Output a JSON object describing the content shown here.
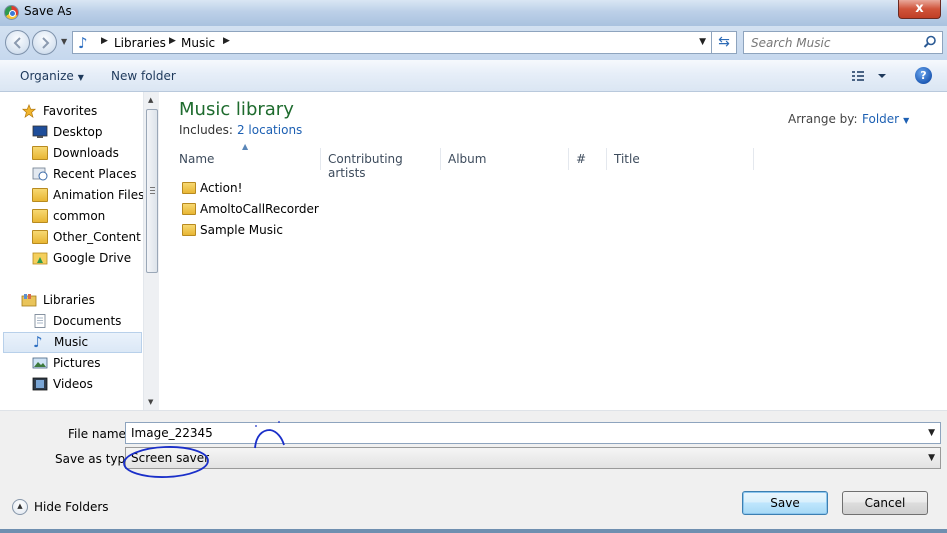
{
  "window": {
    "title": "Save As",
    "close_glyph": "x"
  },
  "address": {
    "crumbs": [
      "Libraries",
      "Music"
    ],
    "icon": "music-note-icon"
  },
  "search": {
    "placeholder": "Search Music"
  },
  "toolbar": {
    "organize_label": "Organize",
    "new_folder_label": "New folder",
    "help_glyph": "?"
  },
  "navigation": {
    "favorites": {
      "header": "Favorites",
      "items": [
        {
          "label": "Desktop",
          "icon": "desktop-icon"
        },
        {
          "label": "Downloads",
          "icon": "downloads-folder-icon"
        },
        {
          "label": "Recent Places",
          "icon": "recent-places-icon"
        },
        {
          "label": "Animation Files",
          "icon": "folder-icon"
        },
        {
          "label": "common",
          "icon": "folder-icon"
        },
        {
          "label": "Other_Content",
          "icon": "folder-icon"
        },
        {
          "label": "Google Drive",
          "icon": "google-drive-icon"
        }
      ]
    },
    "libraries": {
      "header": "Libraries",
      "items": [
        {
          "label": "Documents",
          "icon": "documents-icon"
        },
        {
          "label": "Music",
          "icon": "music-icon",
          "selected": true
        },
        {
          "label": "Pictures",
          "icon": "pictures-icon"
        },
        {
          "label": "Videos",
          "icon": "videos-icon"
        }
      ]
    }
  },
  "library": {
    "title": "Music library",
    "includes_label": "Includes:",
    "locations_link": "2 locations",
    "arrange_label": "Arrange by:",
    "arrange_value": "Folder"
  },
  "columns": [
    "Name",
    "Contributing artists",
    "Album",
    "#",
    "Title"
  ],
  "files": [
    {
      "name": "Action!",
      "icon": "folder-icon"
    },
    {
      "name": "AmoltoCallRecorder",
      "icon": "folder-icon"
    },
    {
      "name": "Sample Music",
      "icon": "folder-icon"
    }
  ],
  "form": {
    "file_name_label": "File name:",
    "file_name_value": "Image_22345",
    "save_type_label": "Save as type:",
    "save_type_value": "Screen saver",
    "hide_folders_label": "Hide Folders",
    "save_label": "Save",
    "cancel_label": "Cancel"
  },
  "colors": {
    "library_title": "#1e6b2e",
    "link": "#1d60b3",
    "annotation_ink": "#1a2fc9"
  }
}
